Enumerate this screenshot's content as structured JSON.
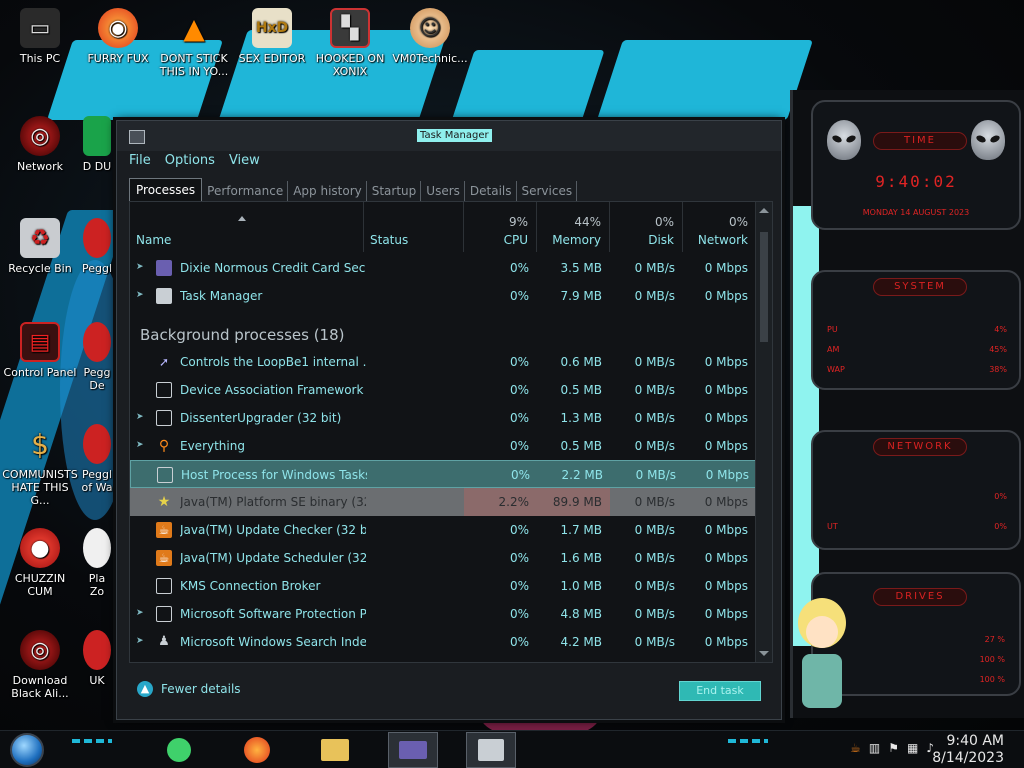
{
  "desktop": {
    "icons": [
      {
        "label": "This PC",
        "icon": "computer-icon"
      },
      {
        "label": "FURRY FUX",
        "icon": "firefox-icon"
      },
      {
        "label": "DONT STICK THIS IN YO...",
        "icon": "vlc-cone-icon"
      },
      {
        "label": "SEX EDITOR",
        "icon": "hxd-editor-icon"
      },
      {
        "label": "HOOKED ON XONIX",
        "icon": "game-icon"
      },
      {
        "label": "VM0Technic...",
        "icon": "doctor-icon"
      },
      {
        "label": "Network",
        "icon": "network-icon"
      },
      {
        "label": "Recycle Bin",
        "icon": "recycle-bin-icon"
      },
      {
        "label": "Control Panel",
        "icon": "control-panel-icon"
      },
      {
        "label": "COMMUNISTS HATE THIS G...",
        "icon": "money-bag-icon"
      },
      {
        "label": "CHUZZIN CUM",
        "icon": "chuzzle-icon"
      },
      {
        "label": "Download Black Ali...",
        "icon": "alien-icon"
      }
    ],
    "partial_icons": [
      {
        "label": "D DU",
        "icon": "app-icon"
      },
      {
        "label": "Peggl",
        "icon": "peggle-icon"
      },
      {
        "label": "Pegg De",
        "icon": "peggle-icon"
      },
      {
        "label": "Peggl of Wa",
        "icon": "peggle-icon"
      },
      {
        "label": "Pla Zo",
        "icon": "plants-icon"
      },
      {
        "label": "UK",
        "icon": "app-icon"
      }
    ]
  },
  "task_manager": {
    "title": "Task Manager",
    "menu": [
      "File",
      "Options",
      "View"
    ],
    "tabs": [
      "Processes",
      "Performance",
      "App history",
      "Startup",
      "Users",
      "Details",
      "Services"
    ],
    "active_tab": "Processes",
    "columns": {
      "name": "Name",
      "status": "Status",
      "cpu": {
        "label": "CPU",
        "pct": "9%"
      },
      "memory": {
        "label": "Memory",
        "pct": "44%"
      },
      "disk": {
        "label": "Disk",
        "pct": "0%"
      },
      "network": {
        "label": "Network",
        "pct": "0%"
      }
    },
    "apps": [
      {
        "name": "Dixie Normous Credit Card Secu...",
        "cpu": "0%",
        "mem": "3.5 MB",
        "disk": "0 MB/s",
        "net": "0 Mbps",
        "icon": "card-icon",
        "expand": true
      },
      {
        "name": "Task Manager",
        "cpu": "0%",
        "mem": "7.9 MB",
        "disk": "0 MB/s",
        "net": "0 Mbps",
        "icon": "task-manager-icon",
        "expand": true
      }
    ],
    "background_group": "Background processes (18)",
    "background": [
      {
        "name": "Controls the LoopBe1 internal ...",
        "cpu": "0%",
        "mem": "0.6 MB",
        "disk": "0 MB/s",
        "net": "0 Mbps",
        "icon": "loop-icon",
        "expand": false
      },
      {
        "name": "Device Association Framework ...",
        "cpu": "0%",
        "mem": "0.5 MB",
        "disk": "0 MB/s",
        "net": "0 Mbps",
        "icon": "window-icon",
        "expand": false
      },
      {
        "name": "DissenterUpgrader (32 bit)",
        "cpu": "0%",
        "mem": "1.3 MB",
        "disk": "0 MB/s",
        "net": "0 Mbps",
        "icon": "window-icon",
        "expand": true
      },
      {
        "name": "Everything",
        "cpu": "0%",
        "mem": "0.5 MB",
        "disk": "0 MB/s",
        "net": "0 Mbps",
        "icon": "magnifier-icon",
        "expand": true
      },
      {
        "name": "Host Process for Windows Tasks",
        "cpu": "0%",
        "mem": "2.2 MB",
        "disk": "0 MB/s",
        "net": "0 Mbps",
        "icon": "window-icon",
        "expand": false,
        "state": "hl"
      },
      {
        "name": "Java(TM) Platform SE binary (32...",
        "cpu": "2.2%",
        "mem": "89.9 MB",
        "disk": "0 MB/s",
        "net": "0 Mbps",
        "icon": "java-star-icon",
        "expand": false,
        "state": "heavy"
      },
      {
        "name": "Java(TM) Update Checker (32 bit)",
        "cpu": "0%",
        "mem": "1.7 MB",
        "disk": "0 MB/s",
        "net": "0 Mbps",
        "icon": "java-icon",
        "expand": false
      },
      {
        "name": "Java(TM) Update Scheduler (32 ...",
        "cpu": "0%",
        "mem": "1.6 MB",
        "disk": "0 MB/s",
        "net": "0 Mbps",
        "icon": "java-icon",
        "expand": false
      },
      {
        "name": "KMS Connection Broker",
        "cpu": "0%",
        "mem": "1.0 MB",
        "disk": "0 MB/s",
        "net": "0 Mbps",
        "icon": "window-icon",
        "expand": false
      },
      {
        "name": "Microsoft Software Protection P...",
        "cpu": "0%",
        "mem": "4.8 MB",
        "disk": "0 MB/s",
        "net": "0 Mbps",
        "icon": "window-icon",
        "expand": true
      },
      {
        "name": "Microsoft Windows Search Inde...",
        "cpu": "0%",
        "mem": "4.2 MB",
        "disk": "0 MB/s",
        "net": "0 Mbps",
        "icon": "search-person-icon",
        "expand": true
      }
    ],
    "fewer_details": "Fewer details",
    "end_task": "End task"
  },
  "widget": {
    "time_title": "TIME",
    "time": "9:40:02",
    "date": "MONDAY 14 AUGUST 2023",
    "system_title": "SYSTEM",
    "system": [
      {
        "label": "PU",
        "value": "4%"
      },
      {
        "label": "AM",
        "value": "45%"
      },
      {
        "label": "WAP",
        "value": "38%"
      }
    ],
    "network_title": "NETWORK",
    "network": [
      {
        "label": "",
        "value": "0%"
      },
      {
        "label": "UT",
        "value": "0%"
      }
    ],
    "drives_title": "DRIVES",
    "drives": [
      "27 %",
      "100 %",
      "100 %"
    ]
  },
  "taskbar": {
    "apps": [
      "green-chat-icon",
      "firefox-icon",
      "file-explorer-icon",
      "card-icon",
      "task-manager-icon"
    ],
    "tray": [
      "java-icon",
      "network-monitor-icon",
      "flag-icon",
      "network-icon",
      "volume-icon"
    ],
    "time": "9:40 AM",
    "date": "8/14/2023"
  },
  "colors": {
    "accent": "#8fe4ea",
    "highlight_row": "#3d6d6e",
    "heavy_row": "#6b6e71",
    "widget_red": "#e02424",
    "end_task": "#2fb9b4"
  }
}
